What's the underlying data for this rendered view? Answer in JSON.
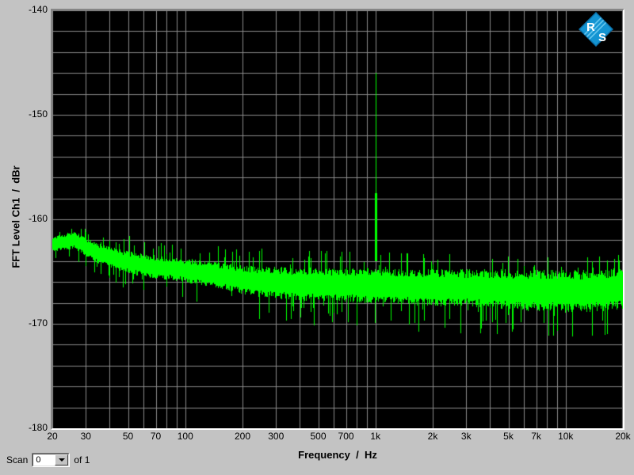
{
  "window": {
    "background": "#c3c3c3"
  },
  "branding": {
    "logo": "rohde-schwarz",
    "logo_color": "#1494d2",
    "logo_stripe_color": "#66c6ee",
    "letter_r": "R",
    "letter_s": "S"
  },
  "axes": {
    "y_title": "FFT Level Ch1  /  dBr",
    "x_title": "Frequency  /  Hz"
  },
  "scan_control": {
    "label": "Scan",
    "value": "0",
    "suffix_label": "of 1"
  },
  "chart_data": {
    "type": "line",
    "title": "",
    "xlabel": "Frequency / Hz",
    "ylabel": "FFT Level Ch1 / dBr",
    "x_scale": "log",
    "xlim": [
      20,
      20000
    ],
    "ylim": [
      -180,
      -140
    ],
    "y_grid_step_db": 2,
    "grid": "on",
    "legend": "none",
    "plot_bg": "#000000",
    "grid_color": "#8b8b8b",
    "trace_color": "#00ff00",
    "x_ticks": [
      {
        "value": 20,
        "label": "20"
      },
      {
        "value": 30,
        "label": "30"
      },
      {
        "value": 50,
        "label": "50"
      },
      {
        "value": 70,
        "label": "70"
      },
      {
        "value": 100,
        "label": "100"
      },
      {
        "value": 200,
        "label": "200"
      },
      {
        "value": 300,
        "label": "300"
      },
      {
        "value": 500,
        "label": "500"
      },
      {
        "value": 700,
        "label": "700"
      },
      {
        "value": 1000,
        "label": "1k"
      },
      {
        "value": 2000,
        "label": "2k"
      },
      {
        "value": 3000,
        "label": "3k"
      },
      {
        "value": 5000,
        "label": "5k"
      },
      {
        "value": 7000,
        "label": "7k"
      },
      {
        "value": 10000,
        "label": "10k"
      },
      {
        "value": 20000,
        "label": "20k"
      }
    ],
    "y_ticks": [
      {
        "value": -140,
        "label": "-140"
      },
      {
        "value": -150,
        "label": "-150"
      },
      {
        "value": -160,
        "label": "-160"
      },
      {
        "value": -170,
        "label": "-170"
      },
      {
        "value": -180,
        "label": "-180"
      }
    ],
    "signal_peak": {
      "frequency_hz": 1000,
      "level_dbr": -146,
      "narrow_above_dbr": -157.5,
      "base_level_dbr": -164
    },
    "noise_floor_envelope": [
      {
        "f": 20,
        "mid": -162.4,
        "spread": 1.0
      },
      {
        "f": 26,
        "mid": -162.0,
        "spread": 1.1
      },
      {
        "f": 34,
        "mid": -163.2,
        "spread": 1.2
      },
      {
        "f": 45,
        "mid": -163.9,
        "spread": 1.3
      },
      {
        "f": 60,
        "mid": -164.4,
        "spread": 1.4
      },
      {
        "f": 90,
        "mid": -164.8,
        "spread": 1.4
      },
      {
        "f": 140,
        "mid": -165.3,
        "spread": 1.6
      },
      {
        "f": 220,
        "mid": -165.9,
        "spread": 1.8
      },
      {
        "f": 400,
        "mid": -166.2,
        "spread": 2.0
      },
      {
        "f": 800,
        "mid": -166.3,
        "spread": 2.1
      },
      {
        "f": 1600,
        "mid": -166.5,
        "spread": 2.2
      },
      {
        "f": 3200,
        "mid": -166.6,
        "spread": 2.3
      },
      {
        "f": 6400,
        "mid": -166.8,
        "spread": 2.5
      },
      {
        "f": 12000,
        "mid": -166.9,
        "spread": 2.6
      },
      {
        "f": 20000,
        "mid": -166.6,
        "spread": 2.5
      }
    ],
    "noise_seed": 1337
  }
}
